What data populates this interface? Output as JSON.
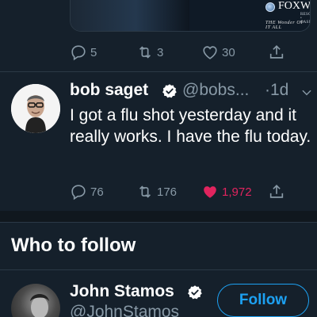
{
  "previous_tweet": {
    "media": {
      "brand_name": "FOXWOODS",
      "brand_subtitle": "RESORT • CASINO",
      "brand_tagline": "THE Wonder OF IT ALL"
    },
    "actions": {
      "replies": "5",
      "retweets": "3",
      "likes": "30"
    }
  },
  "tweet": {
    "display_name": "bob saget",
    "handle": "@bobs...",
    "time": "·1d",
    "text": "I got a flu shot yesterday and it really works.  I have the flu today.",
    "actions": {
      "replies": "76",
      "retweets": "176",
      "likes": "1,972"
    },
    "liked": true
  },
  "who_to_follow": {
    "title": "Who to follow",
    "user": {
      "display_name": "John Stamos",
      "handle": "@JohnStamos",
      "button_label": "Follow"
    }
  },
  "colors": {
    "background": "#15202b",
    "accent": "#1da1f2",
    "muted": "#8899a6",
    "like": "#e0245e"
  }
}
